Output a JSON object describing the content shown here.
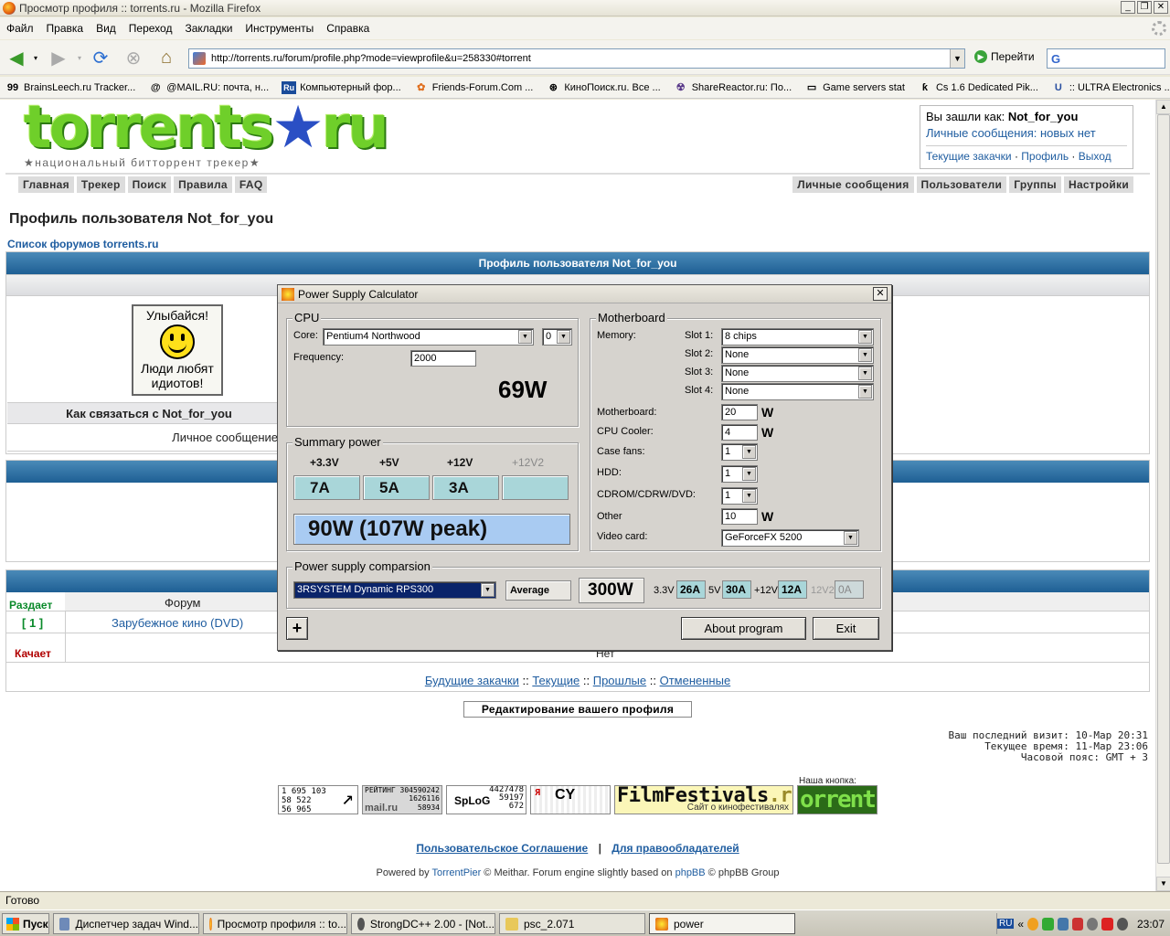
{
  "window": {
    "title": "Просмотр профиля :: torrents.ru - Mozilla Firefox"
  },
  "menu": [
    "Файл",
    "Правка",
    "Вид",
    "Переход",
    "Закладки",
    "Инструменты",
    "Справка"
  ],
  "nav": {
    "url": "http://torrents.ru/forum/profile.php?mode=viewprofile&u=258330#torrent",
    "go_label": "Перейти"
  },
  "bookmarks": [
    {
      "icon": "99",
      "label": "BrainsLeech.ru Tracker..."
    },
    {
      "icon": "@",
      "label": "@MAIL.RU: почта, н..."
    },
    {
      "icon": "Ru",
      "label": "Компьютерный фор..."
    },
    {
      "icon": "✿",
      "label": "Friends-Forum.Com ..."
    },
    {
      "icon": "⊛",
      "label": "КиноПоиск.ru. Все ..."
    },
    {
      "icon": "☢",
      "label": "ShareReactor.ru: По..."
    },
    {
      "icon": "▭",
      "label": "Game servers stat"
    },
    {
      "icon": "ƙ",
      "label": "Cs 1.6 Dedicated Pik..."
    },
    {
      "icon": "U",
      "label": ":: ULTRA Electronics ..."
    }
  ],
  "site": {
    "logo_text": "torrents",
    "logo_star": "★",
    "logo_ru": "ru",
    "logo_sub": "★национальный битторрент трекер★"
  },
  "login": {
    "prefix": "Вы зашли как: ",
    "user": "Not_for_you",
    "pm": "Личные сообщения: новых нет",
    "links": [
      "Текущие закачки",
      "Профиль",
      "Выход"
    ],
    "sep": " · "
  },
  "tabs_left": [
    "Главная",
    "Трекер",
    "Поиск",
    "Правила",
    "FAQ"
  ],
  "tabs_right": [
    "Личные сообщения",
    "Пользователи",
    "Группы",
    "Настройки"
  ],
  "profile": {
    "heading": "Профиль пользователя Not_for_you",
    "crumb": "Список форумов torrents.ru",
    "bar_title": "Профиль пользователя Not_for_you",
    "avatar_top": "Улыбайся!",
    "avatar_bottom1": "Люди любят",
    "avatar_bottom2": "идиотов!",
    "contact": "Как связаться с Not_for_you",
    "pm_label": "Личное сообщение"
  },
  "torrents": {
    "seed_label": "Раздает",
    "seed_count": "[ 1 ]",
    "forum_header": "Форум",
    "forum_link": "Зарубежное кино (DVD)",
    "leech_label": "Качает",
    "leech_none": "Нет",
    "future_links": [
      "Будущие закачки",
      "Текущие",
      "Прошлые",
      "Отмененные"
    ],
    "sep": " :: "
  },
  "edit_button": "Редактирование вашего профиля",
  "visit": {
    "last": "Ваш последний визит: 10-Мар 20:31",
    "now": "Текущее время: 11-Мар 23:06",
    "tz": "Часовой пояс: GMT + 3"
  },
  "counters": {
    "c1": [
      "1 695 103",
      "58 522",
      "56 965"
    ],
    "c2_title": "РЕЙТИНГ",
    "c2": [
      "304590242",
      "1626116",
      "58934"
    ],
    "c2_brand": "mail.ru",
    "c3": [
      "4427478",
      "59197",
      "672"
    ],
    "c3_brand": "SpLoG",
    "c4": "CY",
    "ff_main": "FilmFestivals",
    "ff_ru": ".ru",
    "ff_sub": "Сайт о кинофестивалях",
    "our_label": "Наша кнопка:",
    "our_btn": "orrent"
  },
  "footer": {
    "links": [
      "Пользовательское Соглашение",
      "Для правообладателей"
    ],
    "sep": "|",
    "powered_prefix": "Powered by ",
    "torrentpier": "TorrentPier",
    "mid": " © Meithar. Forum engine slightly based on ",
    "phpbb": "phpBB",
    "suffix": " © phpBB Group"
  },
  "status": "Готово",
  "taskbar": {
    "start": "Пуск",
    "tasks": [
      "Диспетчер задач Wind...",
      "Просмотр профиля :: to...",
      "StrongDC++ 2.00 - [Not...",
      "psc_2.071",
      "power"
    ],
    "lang": "RU",
    "clock": "23:07"
  },
  "dialog": {
    "title": "Power Supply Calculator",
    "cpu": {
      "group": "CPU",
      "core_label": "Core:",
      "core_value": "Pentium4 Northwood",
      "core_count": "0",
      "freq_label": "Frequency:",
      "freq_value": "2000",
      "watts": "69W"
    },
    "summary": {
      "group": "Summary power",
      "rails": [
        "+3.3V",
        "+5V",
        "+12V",
        "+12V2"
      ],
      "amps": [
        "7A",
        "5A",
        "3A",
        ""
      ],
      "total": "90W (107W peak)"
    },
    "motherboard": {
      "group": "Motherboard",
      "memory_label": "Memory:",
      "slots": [
        {
          "label": "Slot 1:",
          "value": "8 chips"
        },
        {
          "label": "Slot 2:",
          "value": "None"
        },
        {
          "label": "Slot 3:",
          "value": "None"
        },
        {
          "label": "Slot 4:",
          "value": "None"
        }
      ],
      "mb_label": "Motherboard:",
      "mb_value": "20",
      "cooler_label": "CPU Cooler:",
      "cooler_value": "4",
      "fans_label": "Case fans:",
      "fans_value": "1",
      "hdd_label": "HDD:",
      "hdd_value": "1",
      "cd_label": "CDROM/CDRW/DVD:",
      "cd_value": "1",
      "other_label": "Other",
      "other_value": "10",
      "video_label": "Video card:",
      "video_value": "GeForceFX 5200",
      "w": "W"
    },
    "comparison": {
      "group": "Power supply comparsion",
      "psu": "3RSYSTEM Dynamic RPS300",
      "mode": "Average",
      "watts": "300W",
      "rails": [
        {
          "label": "3.3V",
          "value": "26A"
        },
        {
          "label": "5V",
          "value": "30A"
        },
        {
          "label": "+12V",
          "value": "12A"
        },
        {
          "label": "12V2",
          "value": "0A"
        }
      ]
    },
    "plus": "+",
    "about": "About program",
    "exit": "Exit"
  }
}
